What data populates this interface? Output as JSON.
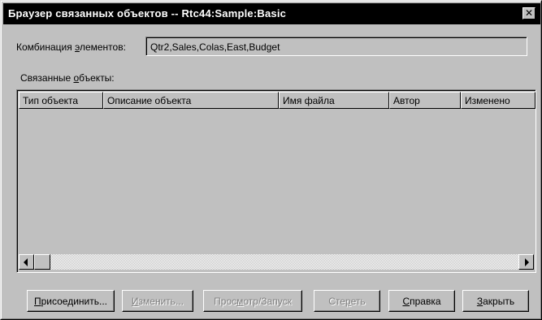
{
  "window": {
    "title": "Браузер связанных объектов  -- Rtc44:Sample:Basic",
    "close_glyph": "✕"
  },
  "combination": {
    "label_pre": "Комбинация ",
    "label_mn": "э",
    "label_post": "лементов:",
    "value": "Qtr2,Sales,Colas,East,Budget"
  },
  "objects": {
    "label_pre": "Связанные ",
    "label_mn": "о",
    "label_post": "бъекты:",
    "columns": [
      "Тип объекта",
      "Описание объекта",
      "Имя файла",
      "Автор",
      "Изменено"
    ],
    "rows": []
  },
  "buttons": {
    "attach": {
      "mn": "П",
      "rest": "рисоединить...",
      "enabled": true
    },
    "edit": {
      "mn": "И",
      "rest": "зменить...",
      "enabled": false
    },
    "view": {
      "pre": "Прос",
      "mn": "м",
      "rest": "отр/Запуск",
      "enabled": false
    },
    "delete": {
      "pre": "Сте",
      "mn": "р",
      "rest": "еть",
      "enabled": false
    },
    "help": {
      "mn": "С",
      "rest": "правка",
      "enabled": true
    },
    "close": {
      "mn": "З",
      "rest": "акрыть",
      "enabled": true
    }
  },
  "icons": {
    "close": "close-icon",
    "scroll_left": "arrow-left-icon",
    "scroll_right": "arrow-right-icon"
  },
  "colors": {
    "titlebar": "#000000",
    "dialog": "#c0c0c0",
    "disabled_text": "#808080"
  }
}
